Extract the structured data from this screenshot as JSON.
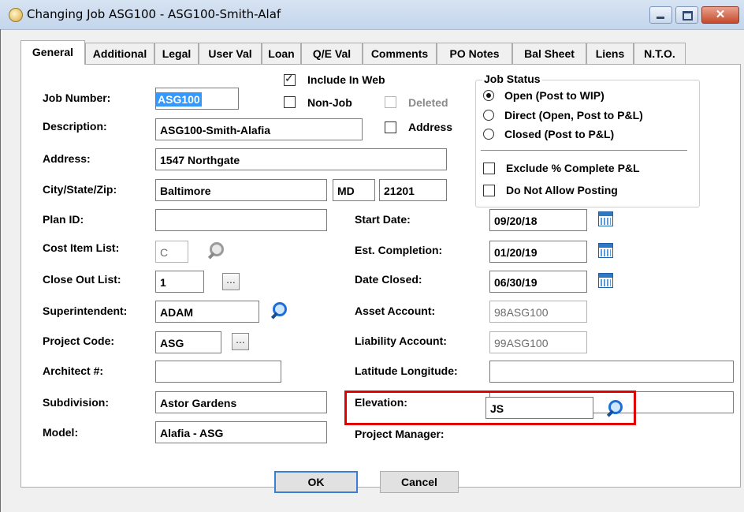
{
  "window": {
    "title": "Changing Job ASG100 - ASG100-Smith-Alaf",
    "close_glyph": "✕"
  },
  "tabs": [
    "General",
    "Additional",
    "Legal",
    "User Val",
    "Loan",
    "Q/E Val",
    "Comments",
    "PO Notes",
    "Bal Sheet",
    "Liens",
    "N.T.O."
  ],
  "labels": {
    "job_number": "Job Number:",
    "description": "Description:",
    "address": "Address:",
    "city_state_zip": "City/State/Zip:",
    "plan_id": "Plan ID:",
    "cost_item_list": "Cost Item List:",
    "close_out_list": "Close Out List:",
    "superintendent": "Superintendent:",
    "project_code": "Project Code:",
    "architect": "Architect #:",
    "subdivision": "Subdivision:",
    "model": "Model:",
    "start_date": "Start Date:",
    "est_completion": "Est. Completion:",
    "date_closed": "Date Closed:",
    "asset_account": "Asset Account:",
    "liability_account": "Liability Account:",
    "lat_long": "Latitude Longitude:",
    "elevation": "Elevation:",
    "project_manager": "Project Manager:"
  },
  "values": {
    "job_number": "ASG100",
    "description": "ASG100-Smith-Alafia",
    "address": "1547 Northgate",
    "city": "Baltimore",
    "state": "MD",
    "zip": "21201",
    "plan_id": "",
    "cost_item_list": "C",
    "close_out_list": "1",
    "superintendent": "ADAM",
    "project_code": "ASG",
    "architect": "",
    "subdivision": "Astor Gardens",
    "model": "Alafia - ASG",
    "start_date": "09/20/18",
    "est_completion": "01/20/19",
    "date_closed": "06/30/19",
    "asset_account": "98ASG100",
    "liability_account": "99ASG100",
    "lat_long": "",
    "elevation": "",
    "project_manager": "JS"
  },
  "checkboxes": {
    "include_in_web": {
      "label": "Include In Web",
      "checked": true,
      "mark": "✓"
    },
    "non_job": {
      "label": "Non-Job",
      "checked": false
    },
    "deleted": {
      "label": "Deleted",
      "checked": false
    },
    "address": {
      "label": "Address",
      "checked": false
    },
    "exclude_pct": {
      "label": "Exclude % Complete P&L",
      "checked": false
    },
    "no_posting": {
      "label": "Do Not Allow Posting",
      "checked": false
    }
  },
  "job_status": {
    "title": "Job Status",
    "options": [
      "Open (Post to WIP)",
      "Direct (Open, Post to P&L)",
      "Closed (Post to P&L)"
    ],
    "selected": "Open (Post to WIP)"
  },
  "ellipsis": "...",
  "buttons": {
    "ok": "OK",
    "cancel": "Cancel"
  }
}
